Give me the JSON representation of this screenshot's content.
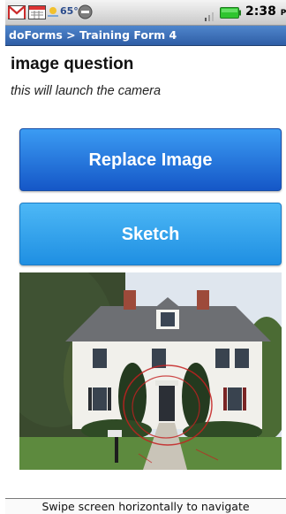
{
  "status_bar": {
    "icons": [
      "gmail-icon",
      "calendar-icon",
      "weather-icon",
      "app-icon",
      "signal-icon",
      "battery-icon"
    ],
    "temperature": "65°",
    "time": "2:38",
    "time_suffix": "PM"
  },
  "title_bar": {
    "title": "doForms > Training Form 4"
  },
  "question": {
    "title": "image question",
    "hint": "this will launch the camera"
  },
  "buttons": {
    "replace_image": "Replace Image",
    "sketch": "Sketch"
  },
  "photo": {
    "subject": "house-photo"
  },
  "footer": {
    "text": "Swipe screen horizontally to navigate"
  },
  "colors": {
    "title_bar": "#3a6fba",
    "replace_button": "#1e6fe0",
    "sketch_button": "#2fa3ee",
    "battery": "#2ec52e"
  }
}
